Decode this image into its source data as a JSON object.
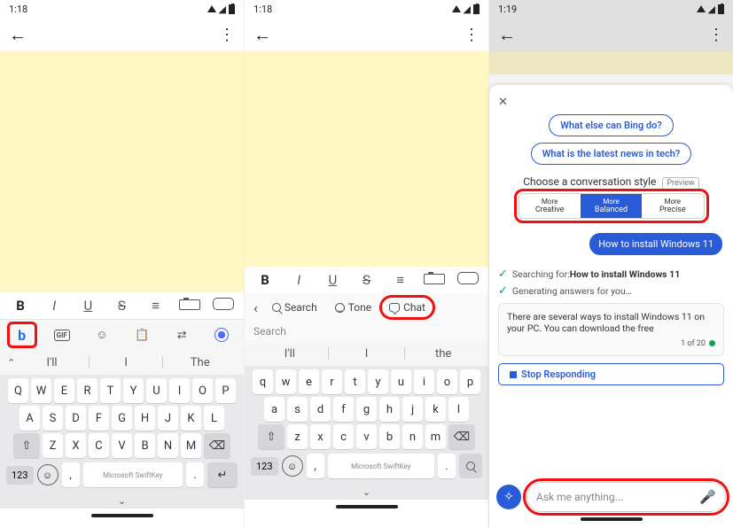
{
  "pane1": {
    "time": "1:18",
    "format": {
      "bold": "B",
      "italic": "I",
      "underline": "U",
      "strike": "S",
      "list": "≡",
      "camera": "",
      "mic": ""
    },
    "kb_top": {
      "bing": "b",
      "gif": "GIF",
      "sticker": "☺",
      "clipboard": "📋",
      "translate": "⇄",
      "target": ""
    },
    "predict": {
      "w1": "I'll",
      "w2": "I",
      "w3": "The"
    },
    "rows": {
      "r1": [
        "Q",
        "W",
        "E",
        "R",
        "T",
        "Y",
        "U",
        "I",
        "O",
        "P"
      ],
      "r2": [
        "A",
        "S",
        "D",
        "F",
        "G",
        "H",
        "J",
        "K",
        "L"
      ],
      "r3": [
        "Z",
        "X",
        "C",
        "V",
        "B",
        "N",
        "M"
      ]
    },
    "shift": "⇧",
    "bksp": "⌫",
    "num": "123",
    "comma": ",",
    "period": ".",
    "enter": "↵",
    "space": "Microsoft SwiftKey",
    "collapse": "⌄"
  },
  "pane2": {
    "time": "1:18",
    "modes": {
      "search": "Search",
      "tone": "Tone",
      "chat": "Chat"
    },
    "search_ph": "Search",
    "predict": {
      "w1": "I'll",
      "w2": "I",
      "w3": "the"
    },
    "rows": {
      "r1": [
        "q",
        "w",
        "e",
        "r",
        "t",
        "y",
        "u",
        "i",
        "o",
        "p"
      ],
      "r2": [
        "a",
        "s",
        "d",
        "f",
        "g",
        "h",
        "j",
        "k",
        "l"
      ],
      "r3": [
        "z",
        "x",
        "c",
        "v",
        "b",
        "n",
        "m"
      ]
    },
    "shift": "⇧",
    "bksp": "⌫",
    "num": "123",
    "comma": ",",
    "period": ".",
    "space": "Microsoft SwiftKey"
  },
  "pane3": {
    "time": "1:19",
    "close": "✕",
    "suggest1": "What else can Bing do?",
    "suggest2": "What is the latest news in tech?",
    "style_heading": "Choose a conversation style",
    "preview": "Preview",
    "styles": {
      "creative_sm": "More",
      "creative": "Creative",
      "balanced_sm": "More",
      "balanced": "Balanced",
      "precise_sm": "More",
      "precise": "Precise"
    },
    "user_msg": "How to install Windows 11",
    "searching_pre": "Searching for: ",
    "searching_q": "How to install Windows 11",
    "generating": "Generating answers for you…",
    "answer": "There are several ways to install Windows 11 on your PC. You can download the free",
    "pager": "1 of 20",
    "stop": "Stop Responding",
    "ask_ph": "Ask me anything..."
  }
}
